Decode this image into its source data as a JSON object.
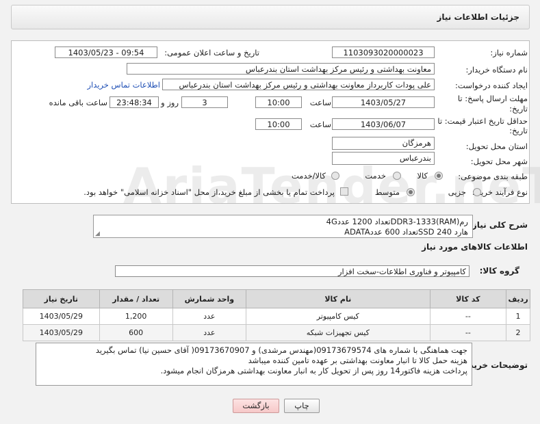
{
  "header": {
    "title": "جزئیات اطلاعات نیاز"
  },
  "form": {
    "need_number_label": "شماره نیاز:",
    "need_number": "1103093020000023",
    "announce_label": "تاریخ و ساعت اعلان عمومی:",
    "announce_value": "1403/05/23 - 09:54",
    "buyer_org_label": "نام دستگاه خریدار:",
    "buyer_org": "معاونت  بهداشتی و رئیس مرکز بهداشت استان بندرعباس",
    "creator_label": "ایجاد کننده درخواست:",
    "creator": "علی پودات کاربرداز معاونت  بهداشتی و رئیس مرکز بهداشت استان بندرعباس",
    "contact_link": "اطلاعات تماس خریدار",
    "deadline_label_1": "مهلت ارسال پاسخ: تا",
    "deadline_label_2": "تاریخ:",
    "deadline_date": "1403/05/27",
    "time_label": "ساعت",
    "deadline_time": "10:00",
    "days_value": "3",
    "day_and_label": "روز و",
    "remaining_time": "23:48:34",
    "remaining_label": "ساعت باقی مانده",
    "price_validity_label_1": "حداقل تاریخ اعتبار قیمت: تا",
    "price_validity_label_2": "تاریخ:",
    "price_validity_date": "1403/06/07",
    "price_validity_time": "10:00",
    "province_label": "استان محل تحویل:",
    "province": "هرمزگان",
    "city_label": "شهر محل تحویل:",
    "city": "بندرعباس",
    "category_label": "طبقه بندی موضوعی:",
    "category_options": [
      "کالا",
      "خدمت",
      "کالا/خدمت"
    ],
    "process_label": "نوع فرآیند خرید :",
    "process_options": [
      "جزیی",
      "متوسط"
    ],
    "payment_note": "پرداخت تمام یا بخشی از مبلغ خرید،از محل \"اسناد خزانه اسلامی\" خواهد بود."
  },
  "description": {
    "label": "شرح کلی نیاز:",
    "line1": "رم(DDR3-1333(RAMتعداد 1200 عدد4G",
    "line2": "هارد SSD 240تعداد 600  عددADATA"
  },
  "goods_info_title": "اطلاعات کالاهای مورد نیاز",
  "goods_group": {
    "label": "گروه کالا:",
    "value": "کامپیوتر و فناوری اطلاعات-سخت افزار"
  },
  "table": {
    "headers": [
      "ردیف",
      "کد کالا",
      "نام کالا",
      "واحد شمارش",
      "تعداد / مقدار",
      "تاریخ نیاز"
    ],
    "rows": [
      [
        "1",
        "--",
        "کیس کامپیوتر",
        "عدد",
        "1,200",
        "1403/05/29"
      ],
      [
        "2",
        "--",
        "کیس تجهیزات شبکه",
        "عدد",
        "600",
        "1403/05/29"
      ]
    ]
  },
  "buyer_notes": {
    "label": "توضیحات خریدار:",
    "line1": "جهت هماهنگی با شماره های 09173679574(مهندس مرشدی) و 09173670907( آقای حسین نیا) تماس بگیرید",
    "line2": "هزینه حمل کالا تا انبار  معاونت بهداشتی بر عهده تامین کننده میباشد",
    "line3": "پرداخت هزینه فاکتور14 روز پس از تحویل کار به انبار معاونت بهداشتی هرمزگان انجام میشود."
  },
  "buttons": {
    "print": "چاپ",
    "back": "بازگشت"
  },
  "watermark": "AriaTender.neT"
}
